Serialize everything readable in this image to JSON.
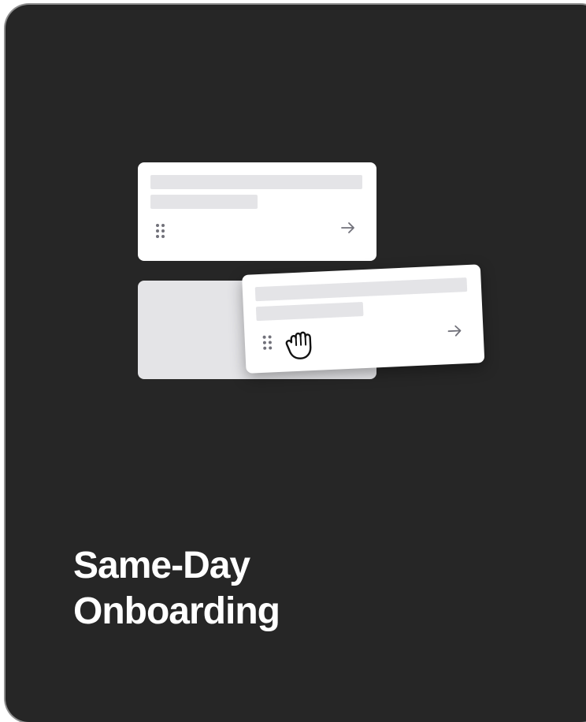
{
  "card": {
    "title_line1": "Same-Day",
    "title_line2": "Onboarding",
    "background": "#262626",
    "title_color": "#ffffff"
  },
  "illustration": {
    "item_icon": "drag-handle-icon",
    "action_icon": "arrow-right-icon",
    "cursor_icon": "grab-hand-icon",
    "placeholder_color": "#e4e4e7"
  }
}
